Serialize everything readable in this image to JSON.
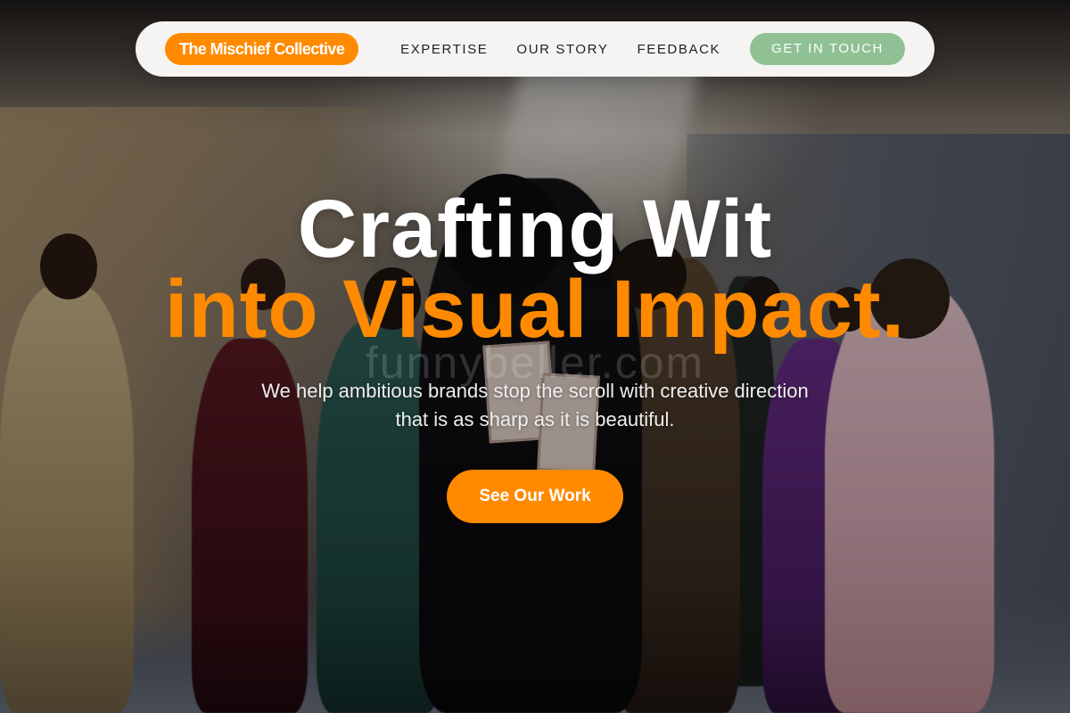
{
  "nav": {
    "brand": "The Mischief Collective",
    "links": [
      "EXPERTISE",
      "OUR STORY",
      "FEEDBACK"
    ],
    "cta": "GET IN TOUCH"
  },
  "hero": {
    "headline_line1": "Crafting Wit",
    "headline_line2": "into Visual Impact.",
    "watermark": "funnybeller.com",
    "subtitle_line1": "We help ambitious brands stop the scroll with creative direction",
    "subtitle_line2": "that is as sharp as it is beautiful.",
    "cta": "See Our Work"
  },
  "colors": {
    "accent_orange": "#ff8a00",
    "accent_green": "#8fc194",
    "nav_background": "#f5f4f2"
  }
}
